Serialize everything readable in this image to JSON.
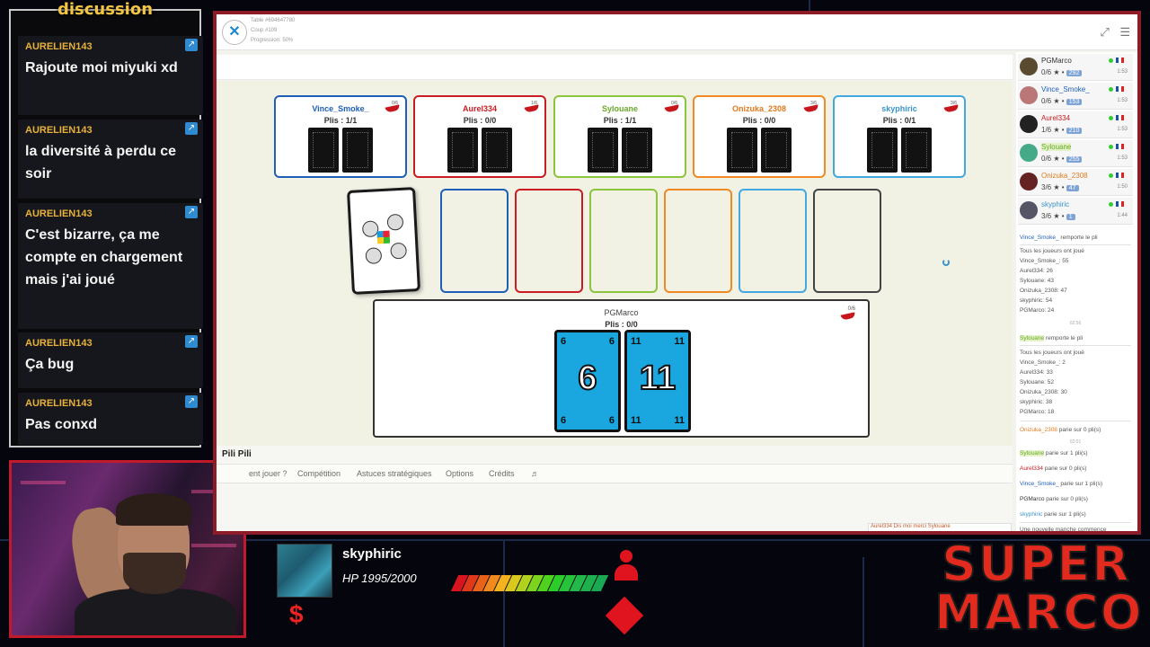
{
  "chat": {
    "title": "discussion",
    "messages": [
      {
        "user": "AURELIEN143",
        "text": "Rajoute moi miyuki xd"
      },
      {
        "user": "AURELIEN143",
        "text": "la diversité à perdu ce soir"
      },
      {
        "user": "AURELIEN143",
        "text": "C'est bizarre, ça me compte en chargement mais j'ai joué"
      },
      {
        "user": "AURELIEN143",
        "text": "Ça bug"
      },
      {
        "user": "AURELIEN143",
        "text": "Pas conxd"
      }
    ]
  },
  "game": {
    "header": {
      "table": "Table #694647780",
      "coup": "Coup #109",
      "progression": "Progression: 50%"
    },
    "opponents": [
      {
        "name": "Vince_Smoke_",
        "plis": "Plis : 1/1",
        "bet": "0/6",
        "color": "#1f5fb8"
      },
      {
        "name": "Aurel334",
        "plis": "Plis : 0/0",
        "bet": "1/6",
        "color": "#c91c25"
      },
      {
        "name": "Sylouane",
        "plis": "Plis : 1/1",
        "bet": "0/6",
        "color": "#8bc53f"
      },
      {
        "name": "Onizuka_2308",
        "plis": "Plis : 0/0",
        "bet": "3/6",
        "color": "#f08a24"
      },
      {
        "name": "skyphiric",
        "plis": "Plis : 0/1",
        "bet": "3/6",
        "color": "#43a8e0"
      }
    ],
    "slot_colors": [
      "#1f5fb8",
      "#c91c25",
      "#8bc53f",
      "#f08a24",
      "#43a8e0",
      "#444444"
    ],
    "me": {
      "name": "PGMarco",
      "plis": "Plis : 0/0",
      "bet": "0/6",
      "cards": [
        {
          "value": "6",
          "corner": "6"
        },
        {
          "value": "11",
          "corner": "11"
        }
      ]
    },
    "title": "Pili Pili",
    "tabs": [
      "ent jouer ?",
      "Compétition",
      "Astuces stratégiques",
      "Options",
      "Crédits",
      "♬"
    ],
    "players": [
      {
        "name": "PGMarco",
        "score": "0/6",
        "rating": "292",
        "time": "1:53",
        "color": "#333333"
      },
      {
        "name": "Vince_Smoke_",
        "score": "0/6",
        "rating": "153",
        "time": "1:53",
        "color": "#1f5fb8"
      },
      {
        "name": "Aurel334",
        "score": "1/6",
        "rating": "210",
        "time": "1:53",
        "color": "#c91c25"
      },
      {
        "name": "Sylouane",
        "score": "0/6",
        "rating": "255",
        "time": "1:53",
        "color": "#6aa82a"
      },
      {
        "name": "Onizuka_2308",
        "score": "3/6",
        "rating": "47",
        "time": "1:50",
        "color": "#e07a1e"
      },
      {
        "name": "skyphiric",
        "score": "3/6",
        "rating": "1",
        "time": "1:44",
        "color": "#3a94cc"
      }
    ],
    "log": {
      "win1_name": "Vince_Smoke_",
      "win1_text": "remporte le pli",
      "block1_title": "Tous les joueurs ont joué",
      "block1": [
        "Vince_Smoke_: 55",
        "Aurel334: 26",
        "Sylouane: 43",
        "Onizuka_2308: 47",
        "skyphiric: 54",
        "PGMarco: 24"
      ],
      "time1": "02:56",
      "win2_name": "Sylouane",
      "win2_text": "remporte le pli",
      "block2_title": "Tous les joueurs ont joué",
      "block2": [
        "Vince_Smoke_: 2",
        "Aurel334: 33",
        "Sylouane: 52",
        "Onizuka_2308: 30",
        "skyphiric: 38",
        "PGMarco: 18"
      ],
      "time2": "02:01",
      "bets": [
        {
          "name": "Onizuka_2308",
          "text": "parie sur 0 pli(s)",
          "color": "#e07a1e"
        },
        {
          "name": "Sylouane",
          "text": "parie sur 1 pli(s)",
          "color": "#6aa82a"
        },
        {
          "name": "Aurel334",
          "text": "parie sur 0 pli(s)",
          "color": "#c91c25"
        },
        {
          "name": "Vince_Smoke_",
          "text": "parie sur 1 pli(s)",
          "color": "#1f5fb8"
        },
        {
          "name": "PGMarco",
          "text": "parie sur 0 pli(s)",
          "color": "#333333"
        },
        {
          "name": "skyphiric",
          "text": "parie sur 1 pli(s)",
          "color": "#3a94cc"
        }
      ],
      "new_round": "Une nouvelle manche commence"
    },
    "chat_line": "Aurel334 Dis moi merci Sylouane"
  },
  "overlay": {
    "sub_name": "skyphiric",
    "hp": "HP 1995/2000",
    "hp_fraction": 0.9975,
    "dollar": "$",
    "logo_line1": "SUPER",
    "logo_line2": "MARCO"
  }
}
